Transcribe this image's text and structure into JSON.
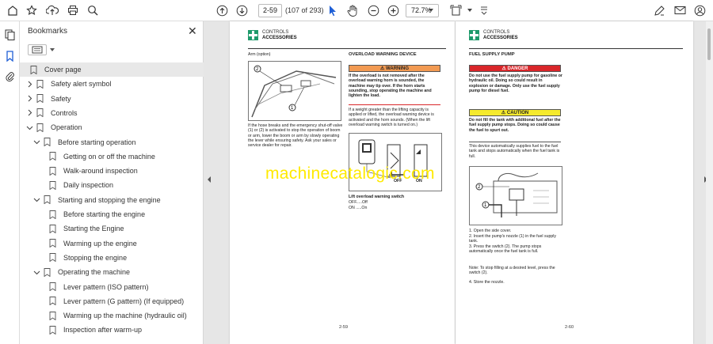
{
  "toolbar": {
    "page_current": "2-59",
    "page_count": "(107 of 293)",
    "zoom": "72.7%"
  },
  "panel": {
    "title": "Bookmarks",
    "items": [
      {
        "label": "Cover page",
        "level": 0,
        "twisty": "none",
        "selected": true
      },
      {
        "label": "Safety alert symbol",
        "level": 0,
        "twisty": "right"
      },
      {
        "label": "Safety",
        "level": 0,
        "twisty": "right"
      },
      {
        "label": "Controls",
        "level": 0,
        "twisty": "right"
      },
      {
        "label": "Operation",
        "level": 0,
        "twisty": "down"
      },
      {
        "label": "Before starting operation",
        "level": 1,
        "twisty": "down"
      },
      {
        "label": "Getting on or off the machine",
        "level": 2,
        "twisty": "none"
      },
      {
        "label": "Walk-around inspection",
        "level": 2,
        "twisty": "none"
      },
      {
        "label": "Daily inspection",
        "level": 2,
        "twisty": "none"
      },
      {
        "label": "Starting and stopping the engine",
        "level": 1,
        "twisty": "down"
      },
      {
        "label": "Before starting the engine",
        "level": 2,
        "twisty": "none"
      },
      {
        "label": "Starting the Engine",
        "level": 2,
        "twisty": "none"
      },
      {
        "label": "Warming up the engine",
        "level": 2,
        "twisty": "none"
      },
      {
        "label": "Stopping the engine",
        "level": 2,
        "twisty": "none"
      },
      {
        "label": "Operating the machine",
        "level": 1,
        "twisty": "down"
      },
      {
        "label": "Lever pattern (ISO pattern)",
        "level": 2,
        "twisty": "none"
      },
      {
        "label": "Lever pattern (G pattern) (If equipped)",
        "level": 2,
        "twisty": "none"
      },
      {
        "label": "Warming up the machine (hydraulic oil)",
        "level": 2,
        "twisty": "none"
      },
      {
        "label": "Inspection after warm-up",
        "level": 2,
        "twisty": "none"
      }
    ]
  },
  "left_page": {
    "section": "CONTROLS",
    "subsection": "ACCESSORIES",
    "arm_title": "Arm (option)",
    "arm_text": "If the hose breaks and the emergency shut-off valve (1) or (2) is activated to stop the operation of boom or arm, lower the boom or arm by slowly operating the lever while ensuring safety. Ask your sales or service dealer for repair.",
    "overload_title": "OVERLOAD WARNING DEVICE",
    "warning_label": "WARNING",
    "warning_text": "If the overload is not removed after the overload warning horn is sounded, the machine may tip over. If the horn starts sounding, stop operating the machine and lighten the load.",
    "overload_text": "If a weight greater than the lifting capacity is applied or lifted, the overload warning device is activated and the horn sounds. (When the lift overload warning switch is turned on.)",
    "switch_off": "OFF",
    "switch_on": "ON",
    "switch_title": "Lift overload warning switch",
    "switch_off_line": "OFF.....Off",
    "switch_on_line": "ON .....On",
    "page_number": "2-59"
  },
  "right_page": {
    "section": "CONTROLS",
    "subsection": "ACCESSORIES",
    "title": "FUEL SUPPLY PUMP",
    "danger_label": "DANGER",
    "danger_text": "Do not use the fuel supply pump for gasoline or hydraulic oil. Doing so could result in explosion or damage. Only use the fuel supply pump for diesel fuel.",
    "caution_label": "CAUTION",
    "caution_text": "Do not fill the tank with additional fuel after the fuel supply pump stops. Doing so could cause the fuel to spurt out.",
    "intro": "This device automatically supplies fuel to the fuel tank and stops automatically when the fuel tank is full.",
    "steps": [
      "1. Open the side cover.",
      "2. Insert the pump's nozzle (1) in the fuel supply tank.",
      "3. Press the switch (2). The pump stops automatically once the fuel tank is full."
    ],
    "note": "Note: To stop filling at a desired level, press the switch (2).",
    "step4": "4. Store the nozzle.",
    "page_number": "2-60"
  },
  "watermark": "machinecatalogic.com",
  "colors": {
    "warning_orange": "#f29a52",
    "danger_red": "#d9262a",
    "caution_yellow": "#f5ea2d",
    "logo_green": "#1f9a6b",
    "watermark_yellow": "#ffea00"
  }
}
